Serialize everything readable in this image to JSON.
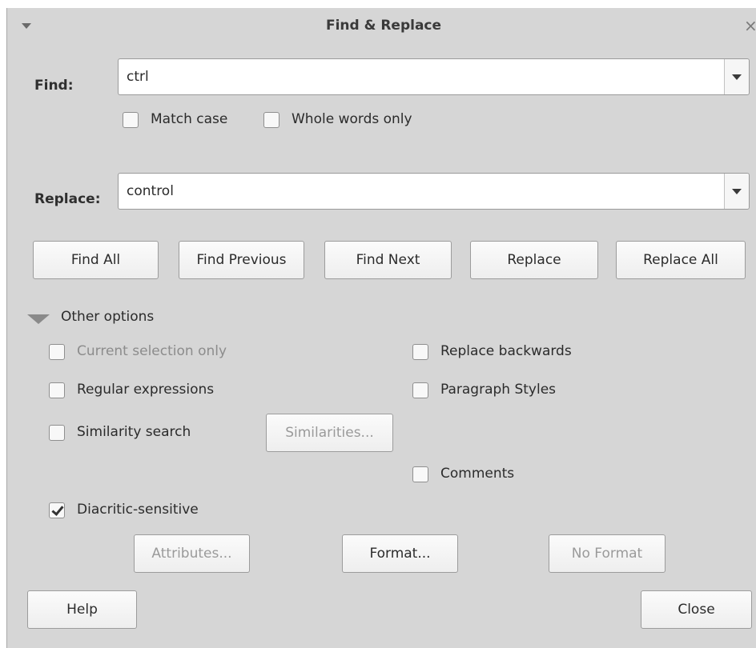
{
  "window": {
    "title": "Find & Replace"
  },
  "find": {
    "label": "Find:",
    "value": "ctrl",
    "match_case": "Match case",
    "whole_words": "Whole words only"
  },
  "replace": {
    "label": "Replace:",
    "value": "control"
  },
  "buttons": {
    "find_all": "Find All",
    "find_previous": "Find Previous",
    "find_next": "Find Next",
    "replace": "Replace",
    "replace_all": "Replace All"
  },
  "other_options": {
    "label": "Other options",
    "current_selection_only": "Current selection only",
    "regular_expressions": "Regular expressions",
    "similarity_search": "Similarity search",
    "similarities_button": "Similarities...",
    "replace_backwards": "Replace backwards",
    "paragraph_styles": "Paragraph Styles",
    "comments": "Comments",
    "diacritic_sensitive": "Diacritic-sensitive",
    "attributes_button": "Attributes...",
    "format_button": "Format...",
    "no_format_button": "No Format"
  },
  "footer": {
    "help": "Help",
    "close": "Close"
  },
  "checked": {
    "diacritic_sensitive": true
  }
}
